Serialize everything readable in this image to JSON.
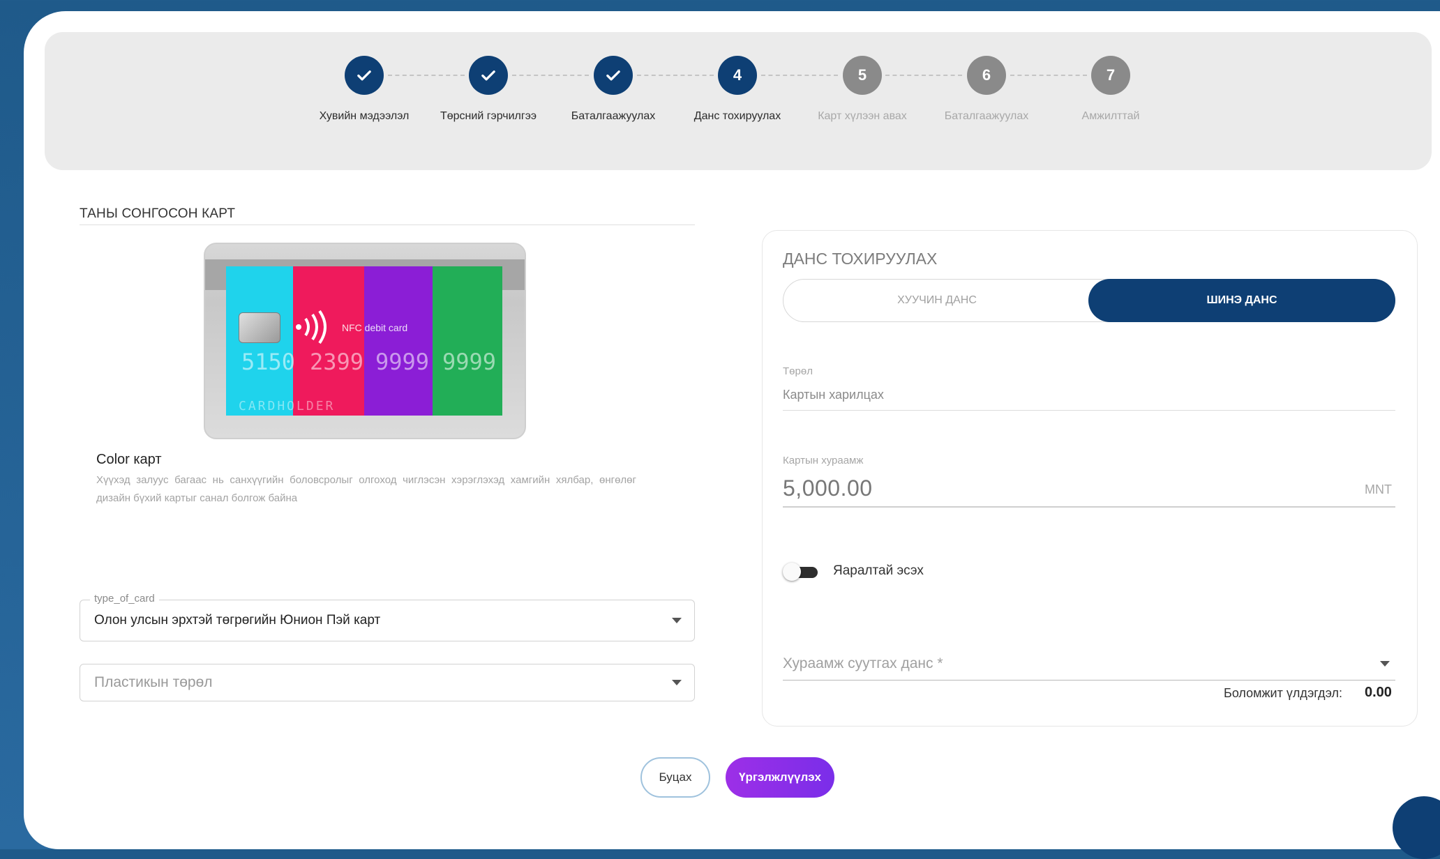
{
  "stepper": {
    "steps": [
      {
        "label": "Хувийн мэдээлэл",
        "state": "done",
        "number": ""
      },
      {
        "label": "Төрсний гэрчилгээ",
        "state": "done",
        "number": ""
      },
      {
        "label": "Баталгаажуулах",
        "state": "done",
        "number": ""
      },
      {
        "label": "Данс тохируулах",
        "state": "active",
        "number": "4"
      },
      {
        "label": "Карт хүлээн авах",
        "state": "pending",
        "number": "5"
      },
      {
        "label": "Баталгаажуулах",
        "state": "pending",
        "number": "6"
      },
      {
        "label": "Амжилттай",
        "state": "pending",
        "number": "7"
      }
    ]
  },
  "card_section": {
    "title": "ТАНЫ СОНГОСОН КАРТ",
    "card_number_groups": [
      "5150",
      "2399",
      "9999",
      "9999"
    ],
    "nfc_label": "NFC debit card",
    "holder": "CARDHOLDER",
    "name": "Color карт",
    "description": "Хүүхэд залуус багаас нь санхүүгийн боловсролыг олгоход чиглэсэн хэрэглэхэд хамгийн хялбар, өнгөлөг дизайн бүхий картыг санал болгож байна",
    "colors": [
      "#1fd3ec",
      "#ef1a5c",
      "#8b1ed6",
      "#22ae57"
    ]
  },
  "type_of_card": {
    "legend": "type_of_card",
    "value": "Олон улсын эрхтэй төгрөгийн Юнион Пэй карт"
  },
  "plastic_type": {
    "placeholder": "Пластикын төрөл"
  },
  "account_setup": {
    "title": "ДАНС ТОХИРУУЛАХ",
    "toggle_old": "ХУУЧИН ДАНС",
    "toggle_new": "ШИНЭ ДАНС",
    "selected": "new",
    "type_label": "Төрөл",
    "type_value": "Картын харилцах",
    "amount_label": "Картын хураамж",
    "amount_value": "5,000.00",
    "currency": "MNT",
    "urgent_label": "Яаралтай эсэх",
    "urgent_on": false,
    "fee_account_placeholder": "Хураамж суутгах данс *",
    "balance_label": "Боломжит үлдэгдэл:",
    "balance_value": "0.00"
  },
  "actions": {
    "back_label": "Буцах",
    "next_label": "Үргэлжлүүлэх"
  },
  "icons": {
    "check": "check-icon",
    "nfc": "nfc-icon",
    "caret": "chevron-down-icon"
  },
  "colors": {
    "primary": "#0e3f74",
    "accent": "#8f2fe8",
    "pending": "#8a8a8a"
  }
}
